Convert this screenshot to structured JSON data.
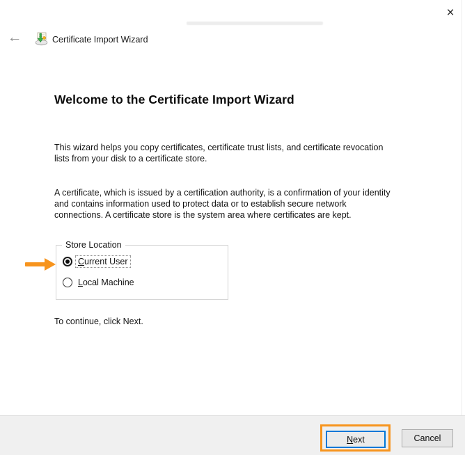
{
  "window": {
    "title": "Certificate Import Wizard",
    "close_icon": "×",
    "back_icon": "←"
  },
  "content": {
    "heading": "Welcome to the Certificate Import Wizard",
    "paragraph1": "This wizard helps you copy certificates, certificate trust lists, and certificate revocation\nlists from your disk to a certificate store.",
    "paragraph2": "A certificate, which is issued by a certification authority, is a confirmation of your identity\nand contains information used to protect data or to establish secure network\nconnections. A certificate store is the system area where certificates are kept.",
    "instruction": "To continue, click Next."
  },
  "store_location": {
    "legend": "Store Location",
    "options": [
      {
        "key": "C",
        "rest": "urrent User",
        "selected": true
      },
      {
        "key": "L",
        "rest": "ocal Machine",
        "selected": false
      }
    ]
  },
  "footer": {
    "next": {
      "key": "N",
      "rest": "ext"
    },
    "cancel_label": "Cancel"
  },
  "colors": {
    "annotation_orange": "#f7941d",
    "focus_blue": "#0078d7",
    "footer_gray": "#f0f0f0"
  }
}
